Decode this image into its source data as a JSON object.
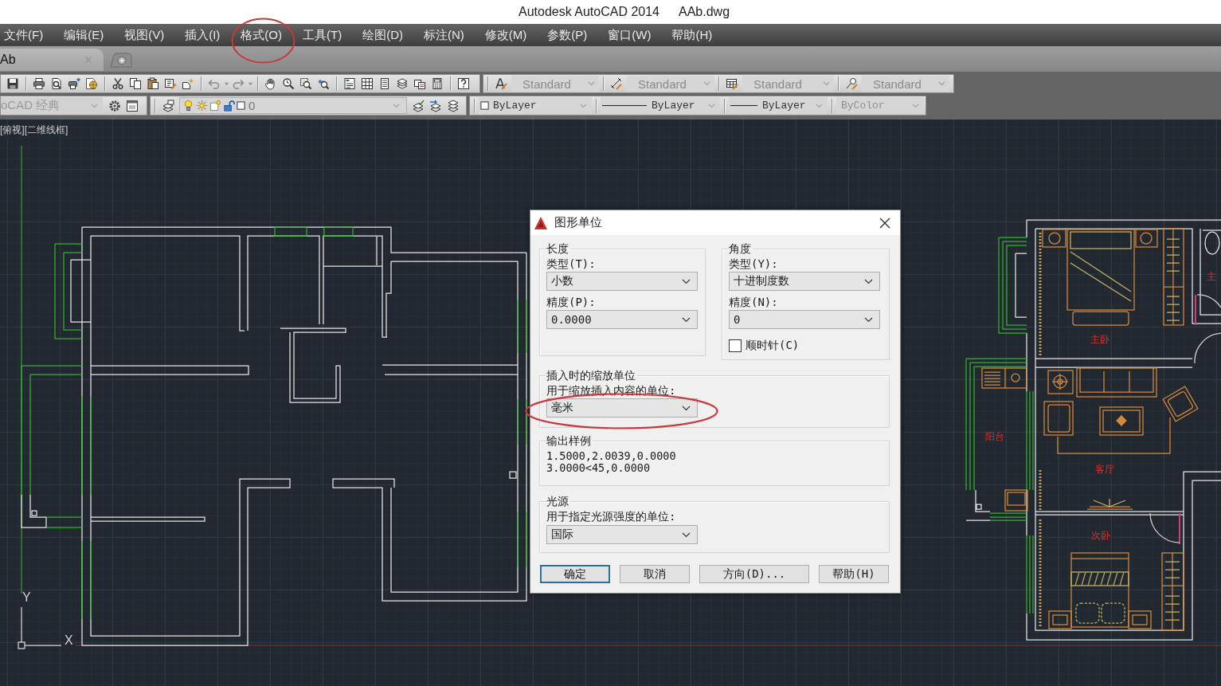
{
  "window": {
    "title": "Autodesk AutoCAD 2014",
    "document": "AAb.dwg"
  },
  "menu": [
    {
      "label": "文件(F)",
      "circled": false
    },
    {
      "label": "编辑(E)",
      "circled": false
    },
    {
      "label": "视图(V)",
      "circled": false
    },
    {
      "label": "插入(I)",
      "circled": false
    },
    {
      "label": "格式(O)",
      "circled": true
    },
    {
      "label": "工具(T)",
      "circled": false
    },
    {
      "label": "绘图(D)",
      "circled": false
    },
    {
      "label": "标注(N)",
      "circled": false
    },
    {
      "label": "修改(M)",
      "circled": false
    },
    {
      "label": "参数(P)",
      "circled": false
    },
    {
      "label": "窗口(W)",
      "circled": false
    },
    {
      "label": "帮助(H)",
      "circled": false
    }
  ],
  "document_tabs": [
    {
      "label": "Ab",
      "selected": true
    }
  ],
  "toolbars": {
    "styles": [
      {
        "value": "Standard"
      },
      {
        "value": "Standard"
      },
      {
        "value": "Standard"
      },
      {
        "value": "Standard"
      }
    ],
    "workspace": {
      "value": "oCAD 经典"
    },
    "layer": {
      "value": "0"
    },
    "properties": [
      {
        "kind": "color",
        "value": "ByLayer",
        "disabled": false
      },
      {
        "kind": "linetype",
        "value": "ByLayer",
        "disabled": false
      },
      {
        "kind": "lineweight",
        "value": "ByLayer",
        "disabled": false
      },
      {
        "kind": "plotstyle",
        "value": "ByColor",
        "disabled": true
      }
    ]
  },
  "viewport": {
    "label": "[俯视][二维线框]",
    "ucs_y": "Y",
    "ucs_x": "X",
    "rooms": [
      {
        "label": "主卧"
      },
      {
        "label": "阳台"
      },
      {
        "label": "客厅"
      },
      {
        "label": "次卧"
      },
      {
        "label": "主"
      }
    ]
  },
  "dialog": {
    "title": "图形单位",
    "length": {
      "legend": "长度",
      "type_label": "类型(T):",
      "type": "小数",
      "precision_label": "精度(P):",
      "precision": "0.0000"
    },
    "angle": {
      "legend": "角度",
      "type_label": "类型(Y):",
      "type": "十进制度数",
      "precision_label": "精度(N):",
      "precision": "0",
      "clockwise_label": "顺时针(C)",
      "clockwise_checked": false
    },
    "insertion": {
      "legend": "插入时的缩放单位",
      "label": "用于缩放插入内容的单位:",
      "units": "毫米",
      "circled": true
    },
    "sample": {
      "legend": "输出样例",
      "lines": [
        "1.5000,2.0039,0.0000",
        "3.0000<45,0.0000"
      ]
    },
    "lighting": {
      "legend": "光源",
      "label": "用于指定光源强度的单位:",
      "units": "国际"
    },
    "buttons": [
      {
        "label": "确定",
        "focused": true
      },
      {
        "label": "取消",
        "focused": false
      },
      {
        "label": "方向(D)...",
        "focused": false
      },
      {
        "label": "帮助(H)",
        "focused": false
      }
    ]
  }
}
